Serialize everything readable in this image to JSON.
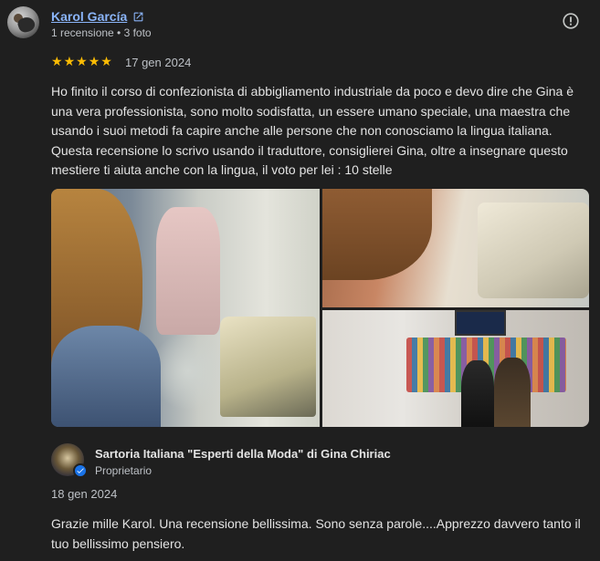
{
  "review": {
    "author_name": "Karol García",
    "author_meta": "1 recensione • 3 foto",
    "rating": 5,
    "stars": [
      "★",
      "★",
      "★",
      "★",
      "★"
    ],
    "date": "17 gen 2024",
    "text": "Ho finito il corso di confezionista di abbigliamento industriale da poco e devo dire che Gina è una vera professionista, sono molto sodisfatta, un essere umano speciale, una maestra che usando i suoi metodi fa capire anche alle persone che non conosciamo la lingua italiana. Questa recensione lo scrivo usando il traduttore, consiglierei Gina, oltre a insegnare questo mestiere ti aiuta anche con la lingua, il voto per lei : 10 stelle",
    "photos_count": 3
  },
  "owner_reply": {
    "name": "Sartoria Italiana \"Esperti della Moda\" di Gina Chiriac",
    "role": "Proprietario",
    "date": "18 gen 2024",
    "text": "Grazie mille Karol. Una recensione bellissima. Sono senza parole....Apprezzo davvero tanto il tuo bellissimo pensiero."
  },
  "icons": {
    "external_link": "external-link-icon",
    "report": "report-icon",
    "verified": "verified-check-icon"
  },
  "colors": {
    "background": "#1f1f1f",
    "link": "#8ab4f8",
    "star": "#fbbc04",
    "verified_badge": "#1a73e8"
  }
}
